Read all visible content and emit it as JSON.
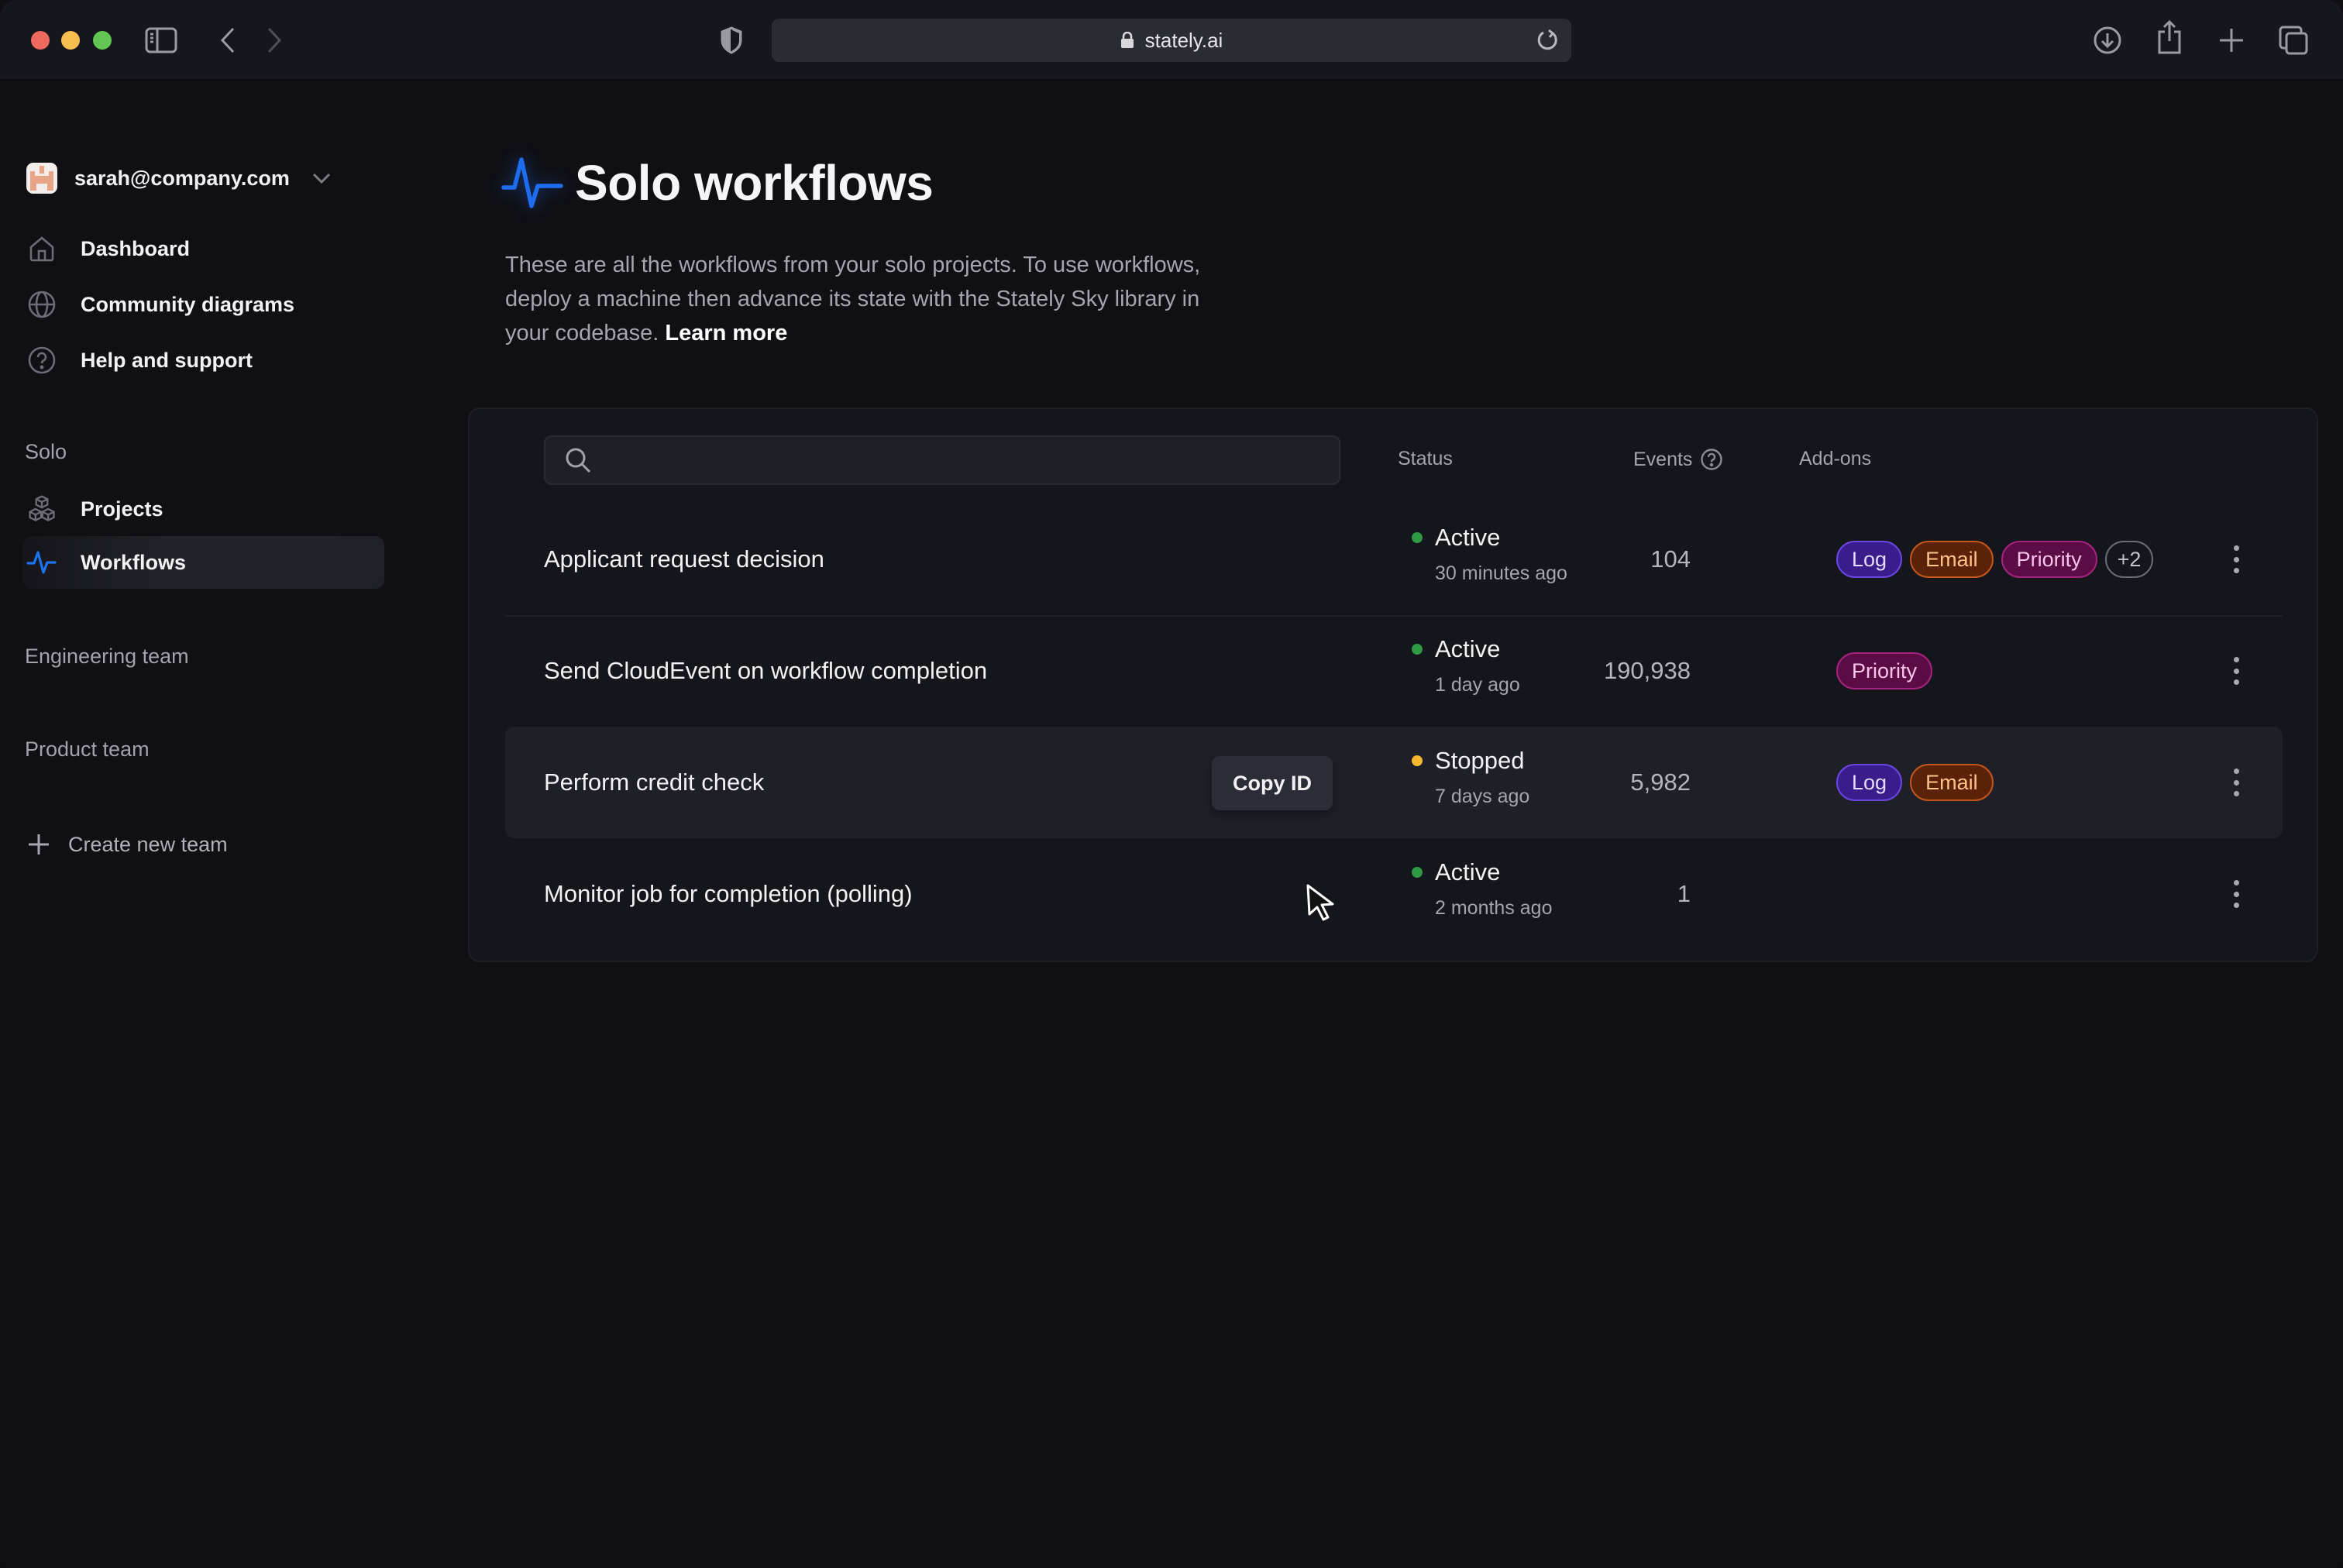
{
  "browser": {
    "url": "stately.ai",
    "icons": {
      "sidebar_toggle": "sidebar-icon",
      "back": "chevron-left-icon",
      "forward": "chevron-right-icon",
      "privacy": "shield-icon",
      "lock": "lock-icon",
      "reload": "reload-icon",
      "download": "download-icon",
      "share": "share-icon",
      "new_tab": "plus-icon",
      "tabs": "tabs-overview-icon"
    }
  },
  "sidebar": {
    "account": {
      "email": "sarah@company.com"
    },
    "primary_nav": [
      {
        "label": "Dashboard",
        "icon": "home-icon"
      },
      {
        "label": "Community diagrams",
        "icon": "globe-icon"
      },
      {
        "label": "Help and support",
        "icon": "help-circle-icon"
      }
    ],
    "solo": {
      "label": "Solo",
      "items": [
        {
          "label": "Projects",
          "icon": "cubes-icon",
          "active": false
        },
        {
          "label": "Workflows",
          "icon": "pulse-icon",
          "active": true
        }
      ]
    },
    "teams": [
      {
        "label": "Engineering team"
      },
      {
        "label": "Product team"
      }
    ],
    "create_team_label": "Create new team"
  },
  "main": {
    "title": "Solo workflows",
    "description": "These are all the workflows from your solo projects. To use workflows, deploy a machine then advance its state with the Stately Sky library in your codebase.",
    "learn_more": "Learn more",
    "search": {
      "value": "",
      "placeholder": ""
    },
    "columns": {
      "status": "Status",
      "events": "Events",
      "addons": "Add-ons"
    },
    "copy_id_label": "Copy ID",
    "rows": [
      {
        "name": "Applicant request decision",
        "status": "Active",
        "status_time": "30 minutes ago",
        "events": "104",
        "addons": [
          "Log",
          "Email",
          "Priority"
        ],
        "addons_more": "+2"
      },
      {
        "name": "Send CloudEvent on workflow completion",
        "status": "Active",
        "status_time": "1 day ago",
        "events": "190,938",
        "addons": [
          "Priority"
        ]
      },
      {
        "name": "Perform credit check",
        "status": "Stopped",
        "status_time": "7 days ago",
        "events": "5,982",
        "addons": [
          "Log",
          "Email"
        ],
        "hovered": true
      },
      {
        "name": "Monitor job for completion (polling)",
        "status": "Active",
        "status_time": "2 months ago",
        "events": "1",
        "addons": []
      }
    ]
  },
  "colors": {
    "accent": "#1e6cf0",
    "status_active": "#2e9a43",
    "status_stopped": "#f5b82e",
    "badge_log": {
      "bg": "#3a1d8a",
      "border": "#6b46e0",
      "text": "#e3dafc"
    },
    "badge_email": {
      "bg": "#5a2208",
      "border": "#c2561b",
      "text": "#ffc38a"
    },
    "badge_priority": {
      "bg": "#5c0c45",
      "border": "#a3247f",
      "text": "#f8c4ea"
    },
    "badge_more": {
      "bg": "transparent",
      "border": "#6c6c75",
      "text": "#c4c4cc"
    }
  }
}
